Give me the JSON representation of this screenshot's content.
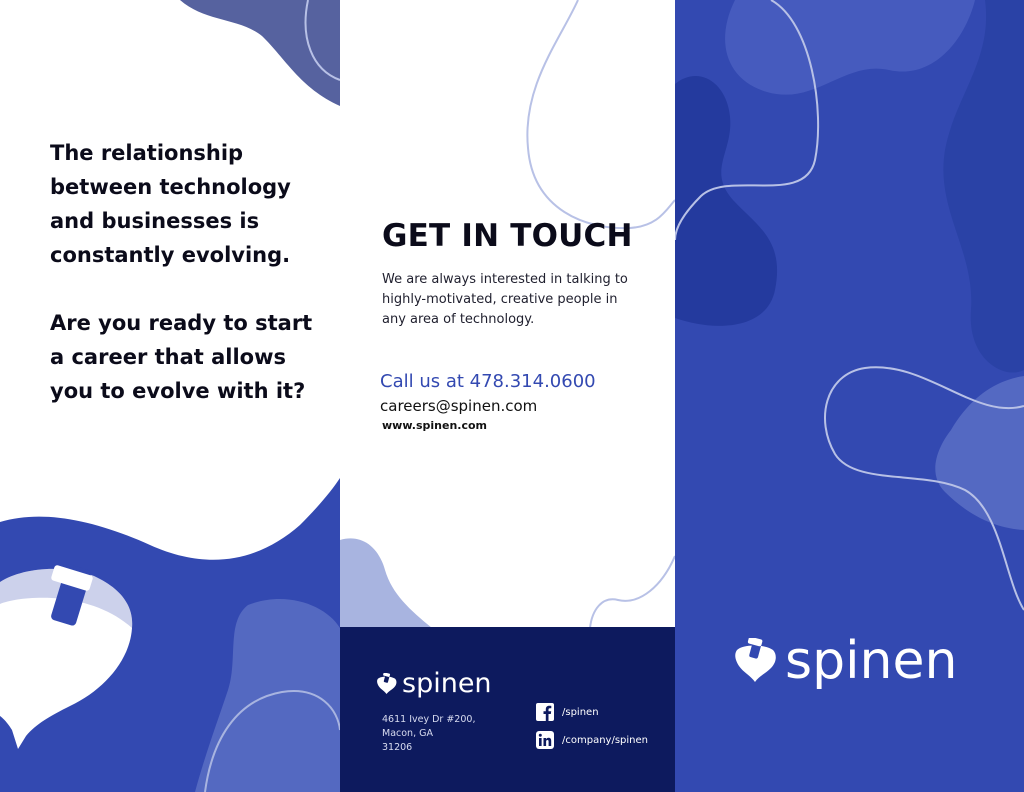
{
  "left_panel": {
    "statement": "The relationship between technology and businesses is constantly evolving.",
    "question": "Are you ready to start a career that allows you to evolve with it?"
  },
  "contact": {
    "title": "GET IN TOUCH",
    "body": "We are always interested in talking to highly-motivated, creative people in any area of technology.",
    "phone": "Call us at 478.314.0600",
    "email": "careers@spinen.com",
    "website": "www.spinen.com"
  },
  "footer": {
    "brand": "spinen",
    "address_lines": [
      "4611 Ivey Dr #200,",
      "Macon, GA",
      "31206"
    ],
    "facebook": "/spinen",
    "linkedin": "/company/spinen"
  },
  "back_cover": {
    "brand": "spinen"
  },
  "colors": {
    "brand_blue": "#3349b1",
    "navy": "#0d1a5e",
    "light_blue": "#a8b4e0",
    "line": "#b8c1e6"
  },
  "icons": [
    "spinen-top-logo-icon",
    "facebook-icon",
    "linkedin-icon"
  ]
}
